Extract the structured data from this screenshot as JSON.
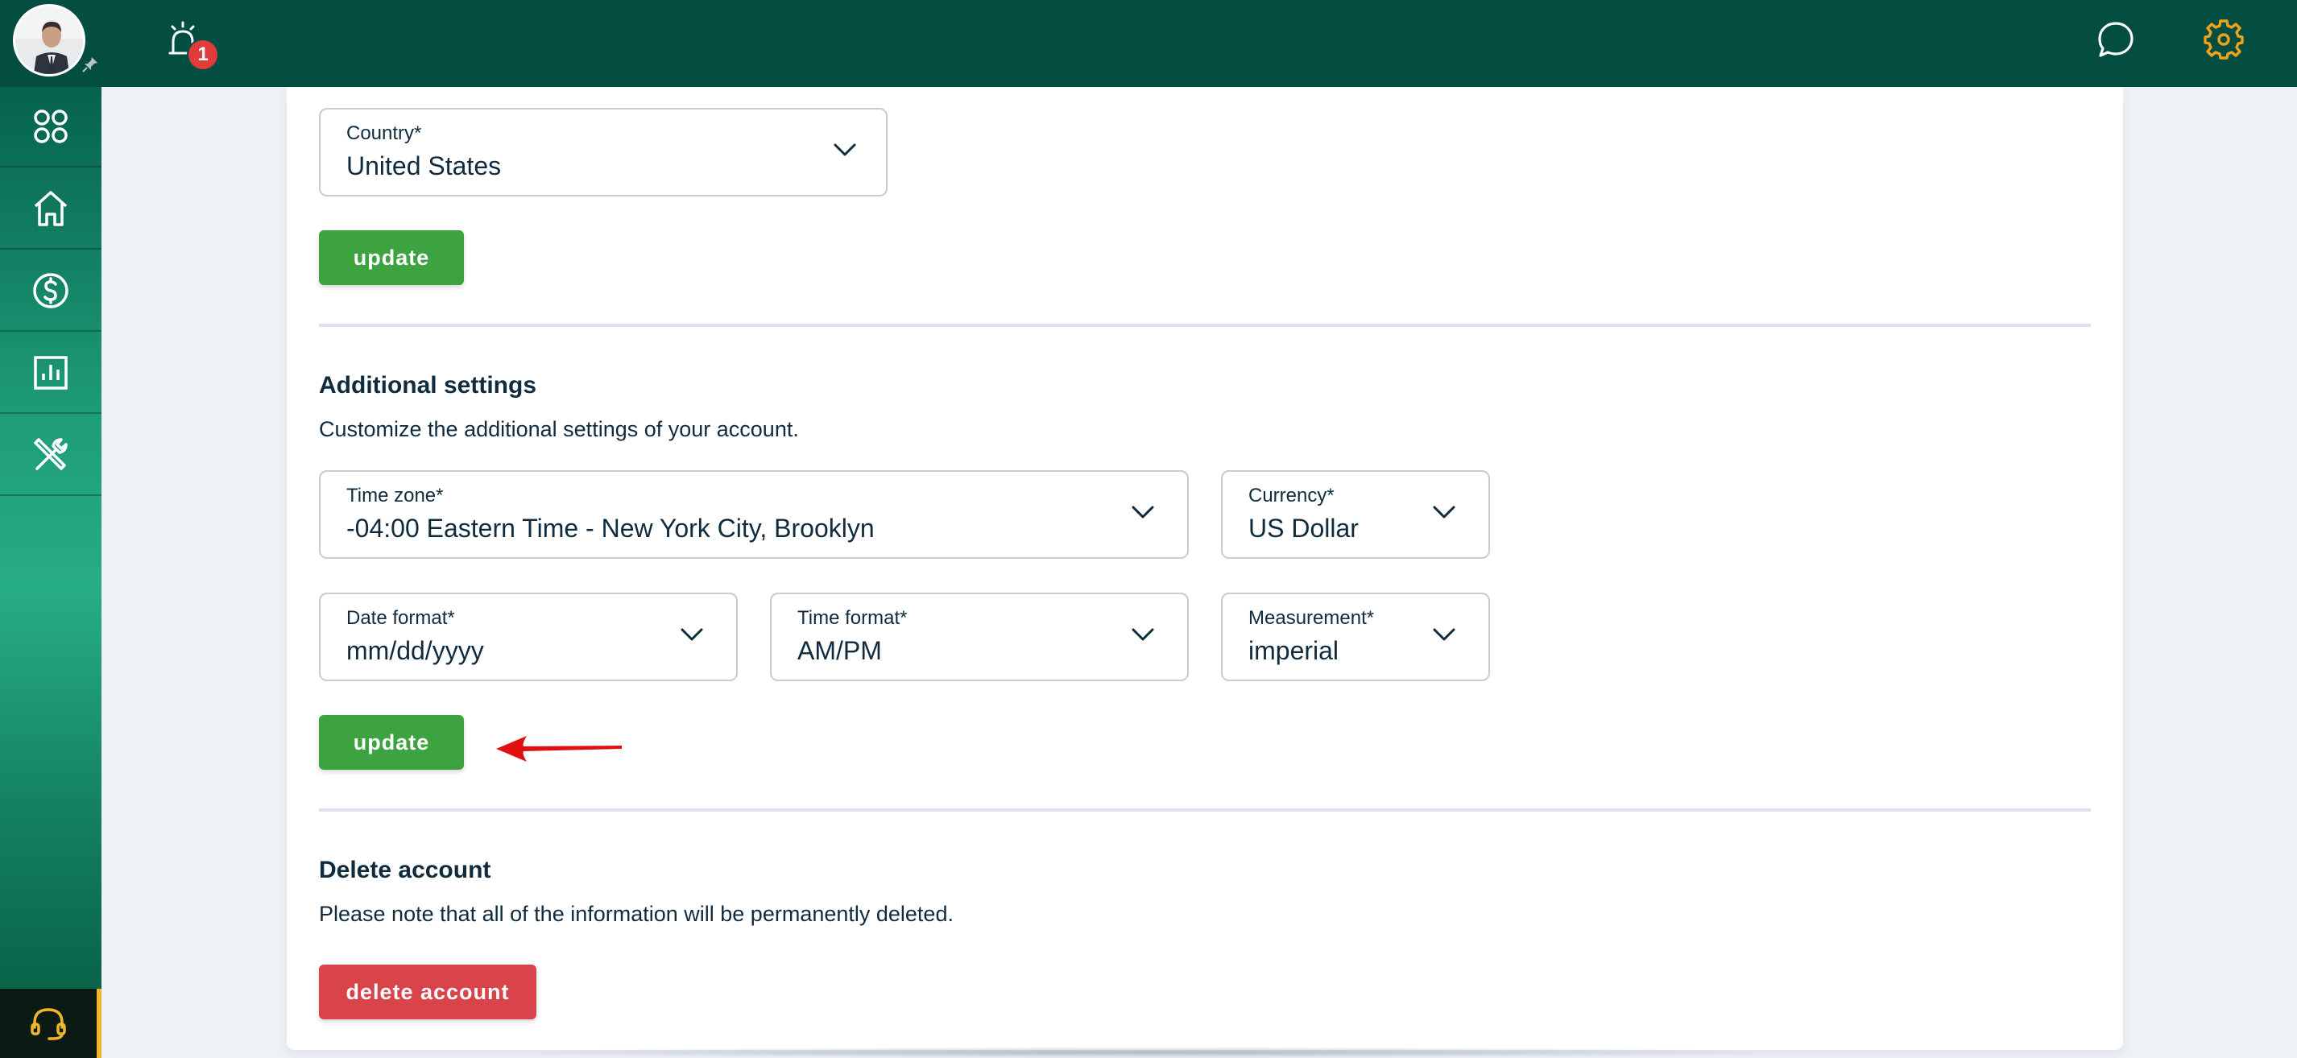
{
  "topbar": {
    "notification_count": "1"
  },
  "icons": {
    "avatar": "user-avatar",
    "pin": "pin-icon",
    "alarm": "alarm-icon",
    "chat": "chat-icon",
    "settings": "gear-icon"
  },
  "sidebar": {
    "items": [
      {
        "icon": "dashboard-icon"
      },
      {
        "icon": "home-icon"
      },
      {
        "icon": "dollar-icon"
      },
      {
        "icon": "chart-icon"
      },
      {
        "icon": "tools-icon"
      }
    ],
    "support_icon": "headset-icon"
  },
  "country": {
    "label": "Country*",
    "value": "United States",
    "update_label": "update"
  },
  "additional": {
    "title": "Additional settings",
    "description": "Customize the additional settings of your account.",
    "timezone": {
      "label": "Time zone*",
      "value": "-04:00 Eastern Time - New York City, Brooklyn"
    },
    "currency": {
      "label": "Currency*",
      "value": "US Dollar"
    },
    "date_format": {
      "label": "Date format*",
      "value": "mm/dd/yyyy"
    },
    "time_format": {
      "label": "Time format*",
      "value": "AM/PM"
    },
    "measurement": {
      "label": "Measurement*",
      "value": "imperial"
    },
    "update_label": "update"
  },
  "delete": {
    "title": "Delete account",
    "description": "Please note that all of the information will be permanently deleted.",
    "button_label": "delete account"
  },
  "colors": {
    "topbar": "#034e41",
    "accent_orange": "#f0a21b",
    "update_green": "#3da341",
    "delete_red": "#d9434a",
    "annotation_arrow": "#e01010"
  }
}
